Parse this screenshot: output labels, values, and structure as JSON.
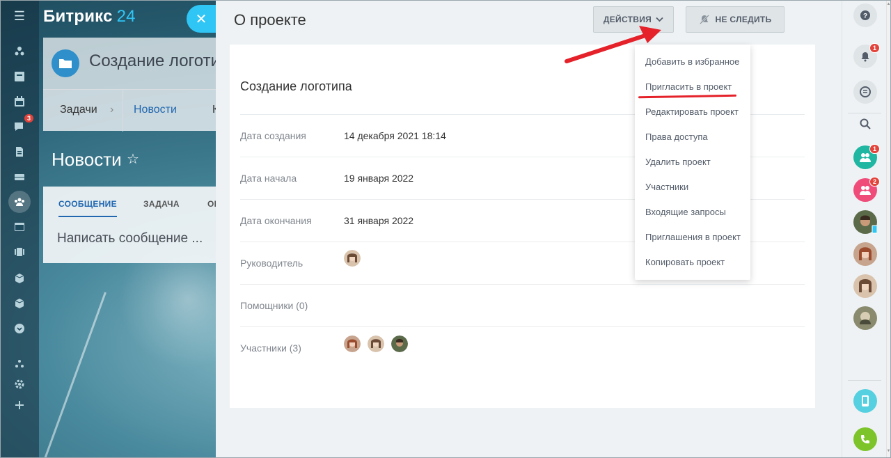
{
  "app": {
    "logo_name": "Битрикс",
    "logo_number": "24"
  },
  "left_nav": {
    "items": [
      {
        "icon": "activity-stream-icon"
      },
      {
        "icon": "tasks-icon"
      },
      {
        "icon": "calendar-icon"
      },
      {
        "icon": "chat-icon",
        "badge": "3"
      },
      {
        "icon": "documents-icon"
      },
      {
        "icon": "drive-icon"
      },
      {
        "icon": "workgroups-icon",
        "active": true
      },
      {
        "icon": "sites-icon"
      },
      {
        "icon": "crm-icon"
      },
      {
        "icon": "box-icon"
      },
      {
        "icon": "box-icon"
      },
      {
        "icon": "more-icon"
      },
      {
        "icon": "sitemap-icon"
      },
      {
        "icon": "settings-icon"
      },
      {
        "icon": "plus-icon"
      }
    ]
  },
  "background_page": {
    "project_title": "Создание логотипа",
    "tabs": [
      "Задачи",
      "Новости",
      "К"
    ],
    "news_title": "Новости",
    "post_tabs": [
      "СООБЩЕНИЕ",
      "ЗАДАЧА",
      "ОП"
    ],
    "write_placeholder": "Написать сообщение ..."
  },
  "panel": {
    "title": "О проекте",
    "actions_label": "ДЕЙСТВИЯ",
    "unfollow_label": "НЕ СЛЕДИТЬ",
    "project_name": "Создание логотипа",
    "rows": [
      {
        "label": "Дата создания",
        "value": "14 декабря 2021 18:14"
      },
      {
        "label": "Дата начала",
        "value": "19 января 2022"
      },
      {
        "label": "Дата окончания",
        "value": "31 января 2022"
      },
      {
        "label": "Руководитель",
        "value": ""
      },
      {
        "label": "Помощники (0)",
        "value": ""
      },
      {
        "label": "Участники (3)",
        "value": ""
      }
    ]
  },
  "dropdown": {
    "items": [
      "Добавить в избранное",
      "Пригласить в проект",
      "Редактировать проект",
      "Права доступа",
      "Удалить проект",
      "Участники",
      "Входящие запросы",
      "Приглашения в проект",
      "Копировать проект"
    ],
    "highlighted": "Пригласить в проект"
  },
  "right_bar": {
    "items": [
      {
        "icon": "help-icon"
      },
      {
        "icon": "notifications-icon",
        "badge": "1"
      },
      {
        "icon": "live-feed-icon"
      },
      {
        "icon": "search-icon"
      },
      {
        "icon": "group-chat-icon",
        "badge": "1"
      },
      {
        "icon": "group-chat-icon",
        "badge": "2"
      },
      {
        "icon": "user-avatar-icon"
      },
      {
        "icon": "user-avatar-icon"
      },
      {
        "icon": "user-avatar-icon"
      },
      {
        "icon": "user-avatar-icon"
      },
      {
        "icon": "mobile-app-icon"
      },
      {
        "icon": "phone-icon"
      }
    ]
  },
  "colors": {
    "accent": "#2fc6f6",
    "badge_red": "#e2433b",
    "highlight_red": "#e5212a",
    "link_blue": "#2067b0",
    "phone_green": "#7dc42b",
    "group_teal": "#1fb6a2",
    "group_pink": "#f04c7a"
  }
}
